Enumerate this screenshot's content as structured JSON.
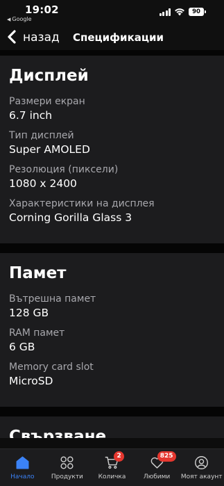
{
  "status": {
    "time": "19:02",
    "back_app": "Google",
    "battery": "90"
  },
  "header": {
    "back_label": "назад",
    "title": "Спецификации"
  },
  "sections": [
    {
      "title": "Дисплей",
      "specs": [
        {
          "label": "Размери екран",
          "value": "6.7 inch"
        },
        {
          "label": "Тип дисплей",
          "value": "Super AMOLED"
        },
        {
          "label": "Резолюция (пиксели)",
          "value": "1080 x 2400"
        },
        {
          "label": "Характеристики на дисплея",
          "value": "Corning Gorilla Glass 3"
        }
      ]
    },
    {
      "title": "Памет",
      "specs": [
        {
          "label": "Вътрешна памет",
          "value": "128 GB"
        },
        {
          "label": "RAM памет",
          "value": "6 GB"
        },
        {
          "label": "Memory card slot",
          "value": "MicroSD"
        }
      ]
    },
    {
      "title": "Свързване",
      "specs": []
    }
  ],
  "bottom_nav": {
    "items": [
      {
        "label": "Начало",
        "icon": "home-icon",
        "active": true
      },
      {
        "label": "Продукти",
        "icon": "grid-icon"
      },
      {
        "label": "Количка",
        "icon": "cart-icon",
        "badge": "2"
      },
      {
        "label": "Любими",
        "icon": "heart-icon",
        "badge": "825"
      },
      {
        "label": "Моят акаунт",
        "icon": "user-icon"
      }
    ]
  },
  "colors": {
    "accent": "#3b82f6",
    "badge": "#e5372f",
    "section_bg": "#1c1c1e",
    "page_bg": "#050505"
  }
}
